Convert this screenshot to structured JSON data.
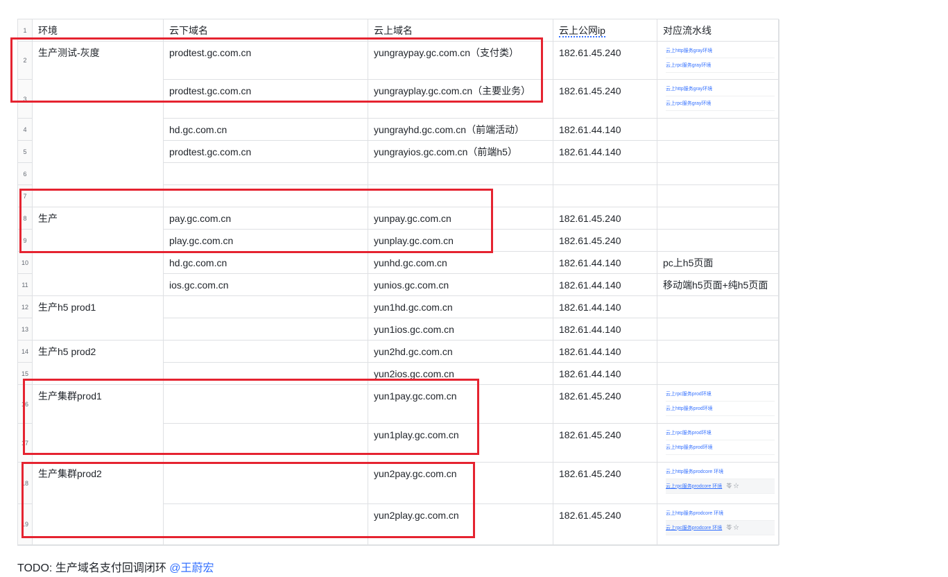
{
  "header": {
    "row_label": "1",
    "cols": [
      "环境",
      "云下域名",
      "云上域名",
      "云上公网ip",
      "对应流水线"
    ]
  },
  "rows": [
    {
      "num": "2",
      "env": "生产测试-灰度",
      "down": "prodtest.gc.com.cn",
      "up": "yungraypay.gc.com.cn（支付类）",
      "ip": "182.61.45.240",
      "pipes": [
        {
          "label": "云上http服务gray环境"
        },
        {
          "label": "云上rpc服务gray环境"
        }
      ]
    },
    {
      "num": "3",
      "env": "",
      "down": "prodtest.gc.com.cn",
      "up": "yungrayplay.gc.com.cn（主要业务）",
      "ip": "182.61.45.240",
      "pipes": [
        {
          "label": "云上http服务gray环境"
        },
        {
          "label": "云上rpc服务gray环境"
        }
      ]
    },
    {
      "num": "4",
      "env": "",
      "down": "hd.gc.com.cn",
      "up": "yungrayhd.gc.com.cn（前端活动）",
      "ip": "182.61.44.140",
      "pipeline_text": ""
    },
    {
      "num": "5",
      "env": "",
      "down": "prodtest.gc.com.cn",
      "up": "yungrayios.gc.com.cn（前端h5）",
      "ip": "182.61.44.140",
      "pipeline_text": ""
    },
    {
      "num": "6",
      "env": "",
      "down": "",
      "up": "",
      "ip": "",
      "pipeline_text": ""
    },
    {
      "num": "7",
      "env": "",
      "down": "",
      "up": "",
      "ip": "",
      "pipeline_text": ""
    },
    {
      "num": "8",
      "env": "生产",
      "down": "pay.gc.com.cn",
      "up": "yunpay.gc.com.cn",
      "ip": "182.61.45.240",
      "pipeline_text": ""
    },
    {
      "num": "9",
      "env": "",
      "down": "play.gc.com.cn",
      "up": "yunplay.gc.com.cn",
      "ip": "182.61.45.240",
      "pipeline_text": ""
    },
    {
      "num": "10",
      "env": "",
      "down": "hd.gc.com.cn",
      "up": "yunhd.gc.com.cn",
      "ip": "182.61.44.140",
      "pipeline_text": "pc上h5页面"
    },
    {
      "num": "11",
      "env": "",
      "down": "ios.gc.com.cn",
      "up": "yunios.gc.com.cn",
      "ip": "182.61.44.140",
      "pipeline_text": "移动端h5页面+纯h5页面"
    },
    {
      "num": "12",
      "env": "生产h5 prod1",
      "down": "",
      "up": "yun1hd.gc.com.cn",
      "ip": "182.61.44.140",
      "pipeline_text": ""
    },
    {
      "num": "13",
      "env": "",
      "down": "",
      "up": "yun1ios.gc.com.cn",
      "ip": "182.61.44.140",
      "pipeline_text": ""
    },
    {
      "num": "14",
      "env": "生产h5 prod2",
      "down": "",
      "up": "yun2hd.gc.com.cn",
      "ip": "182.61.44.140",
      "pipeline_text": ""
    },
    {
      "num": "15",
      "env": "",
      "down": "",
      "up": "yun2ios.gc.com.cn",
      "ip": "182.61.44.140",
      "pipeline_text": ""
    },
    {
      "num": "16",
      "env": "生产集群prod1",
      "down": "",
      "up": "yun1pay.gc.com.cn",
      "ip": "182.61.45.240",
      "pipes": [
        {
          "label": "云上rpc服务prod环境"
        },
        {
          "label": "云上http服务prod环境"
        }
      ]
    },
    {
      "num": "17",
      "env": "",
      "down": "",
      "up": "yun1play.gc.com.cn",
      "ip": "182.61.45.240",
      "pipes": [
        {
          "label": "云上rpc服务prod环境"
        },
        {
          "label": "云上http服务prod环境"
        }
      ]
    },
    {
      "num": "18",
      "env": "生产集群prod2",
      "down": "",
      "up": "yun2pay.gc.com.cn",
      "ip": "182.61.45.240",
      "pipes": [
        {
          "label": "云上http服务prodcore 环境"
        },
        {
          "label": "云上rpc服务prodcore 环境",
          "extra": "苓 ☆"
        }
      ]
    },
    {
      "num": "19",
      "env": "",
      "down": "",
      "up": "yun2play.gc.com.cn",
      "ip": "182.61.45.240",
      "pipes": [
        {
          "label": "云上http服务prodcore 环境"
        },
        {
          "label": "云上rpc服务prodcore 环境",
          "extra": "苓 ☆"
        }
      ]
    }
  ],
  "footer": {
    "todo": "TODO: 生产域名支付回调闭环 ",
    "mention": "@王蔚宏"
  },
  "colors": {
    "annotation_red": "#e52330",
    "link_blue": "#3370ff",
    "grid": "#dee0e3"
  }
}
